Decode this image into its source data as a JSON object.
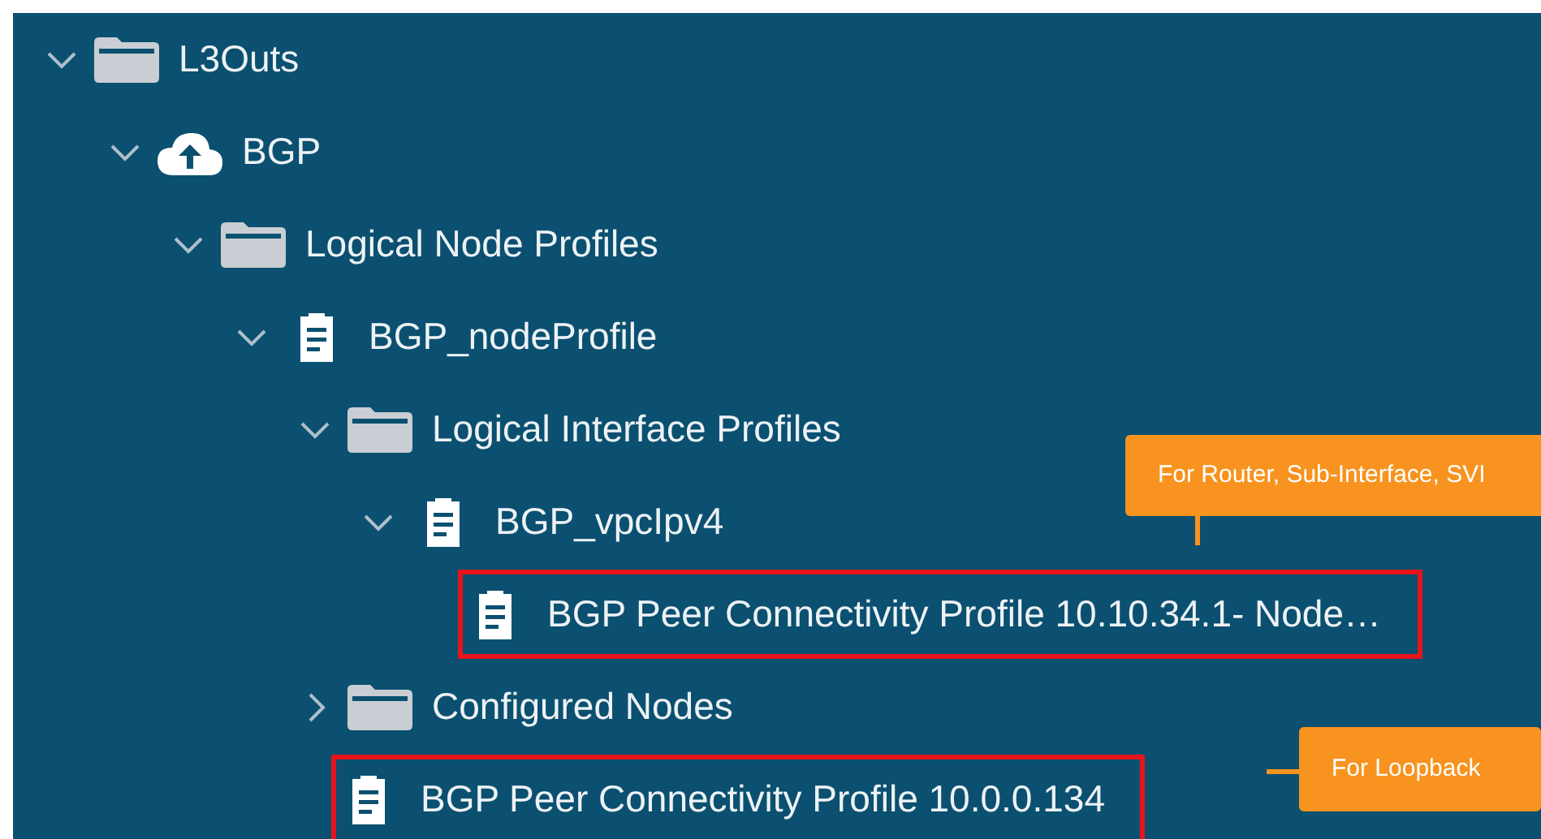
{
  "tree": [
    {
      "label": "L3Outs",
      "kind": "folder",
      "expanded": true,
      "children": [
        {
          "label": "BGP",
          "kind": "cloud",
          "expanded": true,
          "children": [
            {
              "label": "Logical Node Profiles",
              "kind": "folder",
              "expanded": true,
              "children": [
                {
                  "label": "BGP_nodeProfile",
                  "kind": "document",
                  "expanded": true,
                  "children": [
                    {
                      "label": "Logical Interface Profiles",
                      "kind": "folder",
                      "expanded": true,
                      "children": [
                        {
                          "label": "BGP_vpcIpv4",
                          "kind": "document",
                          "expanded": true,
                          "children": [
                            {
                              "label": "BGP Peer Connectivity Profile 10.10.34.1- Node…",
                              "kind": "document",
                              "highlighted": true
                            }
                          ]
                        }
                      ]
                    },
                    {
                      "label": "Configured Nodes",
                      "kind": "folder",
                      "expanded": false
                    },
                    {
                      "label": "BGP Peer Connectivity Profile 10.0.0.134",
                      "kind": "document",
                      "highlighted": true
                    }
                  ]
                }
              ]
            }
          ]
        }
      ]
    }
  ],
  "callouts": [
    {
      "text": "For Router, Sub-Interface, SVI"
    },
    {
      "text": "For Loopback"
    }
  ]
}
